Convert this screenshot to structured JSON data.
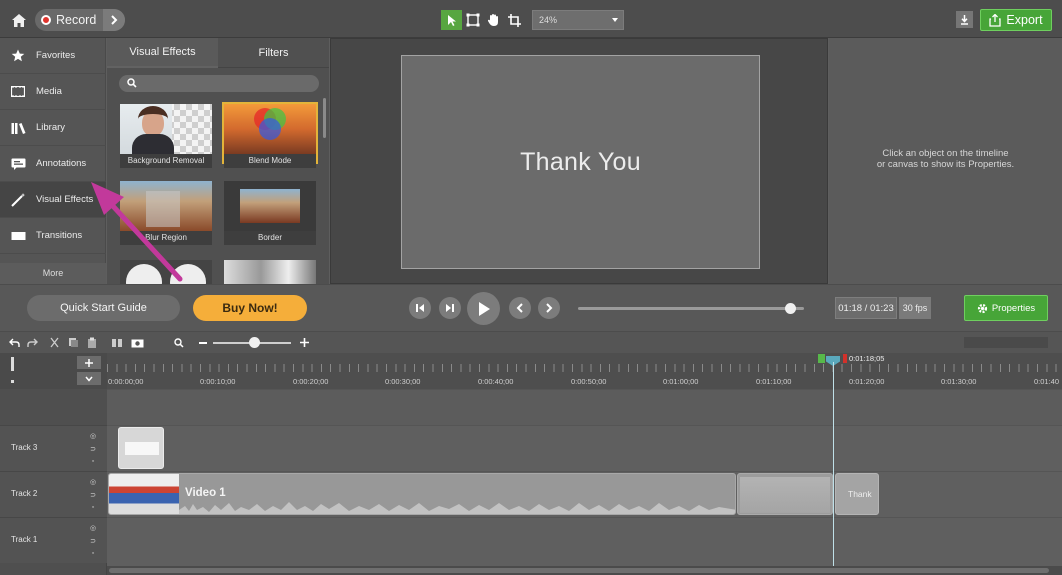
{
  "topbar": {
    "record_label": "Record",
    "zoom_value": "24%",
    "export_label": "Export"
  },
  "sidebar": {
    "items": [
      {
        "label": "Favorites",
        "icon": "star-icon"
      },
      {
        "label": "Media",
        "icon": "film-icon"
      },
      {
        "label": "Library",
        "icon": "library-icon"
      },
      {
        "label": "Annotations",
        "icon": "annotation-icon"
      },
      {
        "label": "Visual Effects",
        "icon": "wand-icon"
      },
      {
        "label": "Transitions",
        "icon": "transition-icon"
      }
    ],
    "more_label": "More"
  },
  "panel": {
    "tabs": [
      "Visual Effects",
      "Filters"
    ],
    "thumbnails": [
      "Background Removal",
      "Blend Mode",
      "Blur Region",
      "Border"
    ]
  },
  "canvas": {
    "slide_text": "Thank You"
  },
  "properties": {
    "message_line1": "Click an object on the timeline",
    "message_line2": "or canvas to show its Properties."
  },
  "playback": {
    "quick_start_label": "Quick Start Guide",
    "buy_label": "Buy Now!",
    "time": "01:18 / 01:23",
    "fps": "30 fps",
    "properties_label": "Properties",
    "progress": 0.94
  },
  "timeline": {
    "playhead_time": "0:01:18;05",
    "ruler_labels": [
      "0:00:00;00",
      "0:00:10;00",
      "0:00:20;00",
      "0:00:30;00",
      "0:00:40;00",
      "0:00:50;00",
      "0:01:00;00",
      "0:01:10;00",
      "0:01:20;00",
      "0:01:30;00",
      "0:01:40"
    ],
    "tracks": [
      "Track 3",
      "Track 2",
      "Track 1"
    ],
    "video_clip_label": "Video 1",
    "thank_clip_label": "Thank"
  },
  "colors": {
    "accent_green": "#47a538",
    "buy_orange": "#f5ae3a",
    "record_red": "#e0342d",
    "arrow_magenta": "#c2399b",
    "selection_gold": "#e3b43a"
  }
}
